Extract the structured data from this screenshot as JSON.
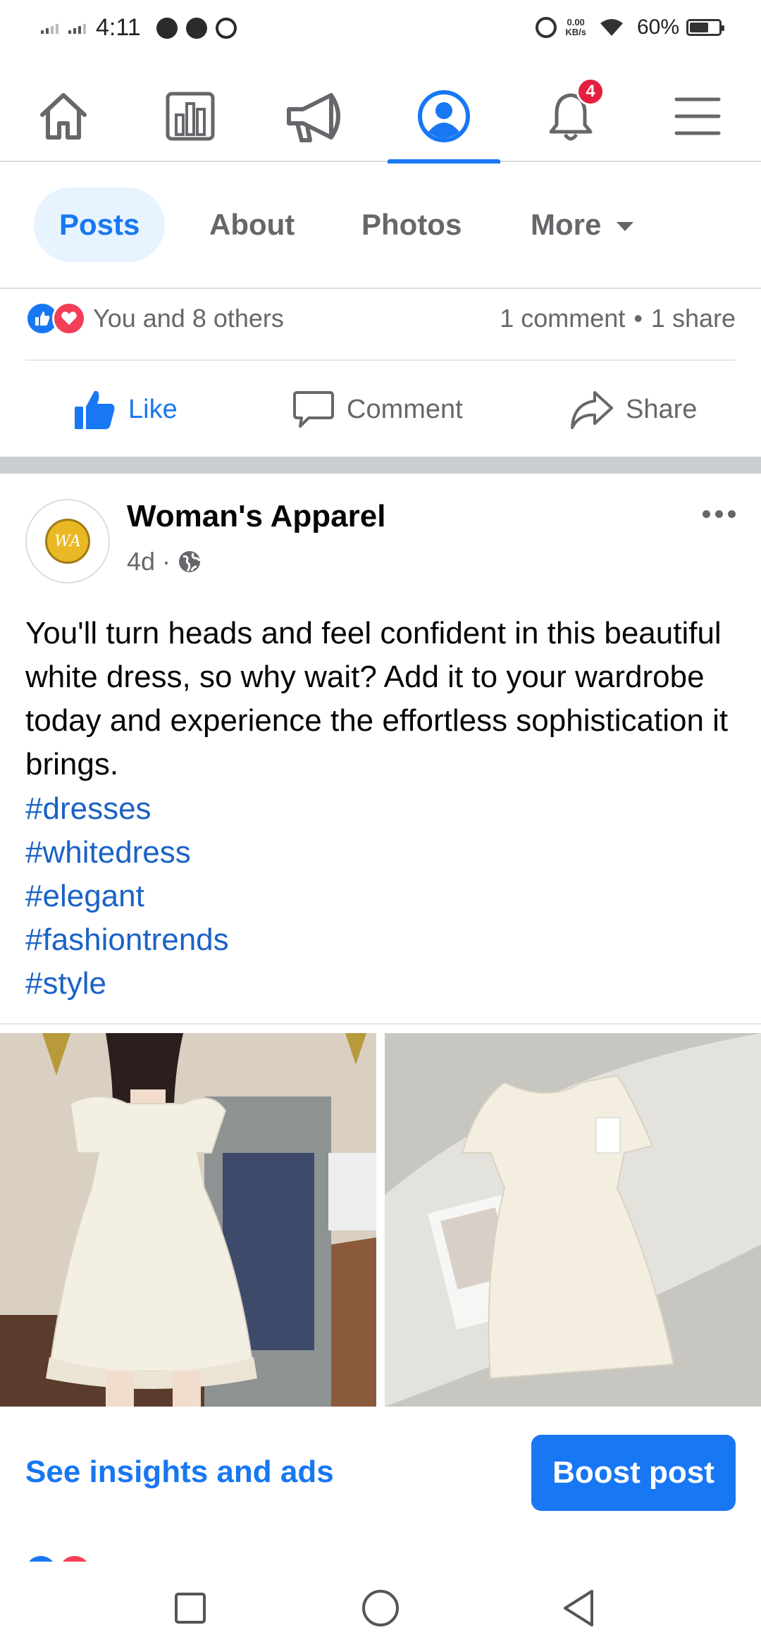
{
  "status_bar": {
    "time": "4:11",
    "net_speed_value": "0.00",
    "net_speed_unit": "KB/s",
    "battery": "60%"
  },
  "top_nav": {
    "icons": [
      "home-icon",
      "pages-icon",
      "megaphone-icon",
      "profile-icon",
      "bell-icon",
      "menu-icon"
    ],
    "active": "profile-icon",
    "notification_count": "4"
  },
  "tabs": {
    "posts": "Posts",
    "about": "About",
    "photos": "Photos",
    "more": "More"
  },
  "reactions": {
    "summary": "You and 8 others",
    "comments": "1 comment",
    "separator": "•",
    "shares": "1 share"
  },
  "actions": {
    "like": "Like",
    "comment": "Comment",
    "share": "Share"
  },
  "post": {
    "page_name": "Woman's Apparel",
    "time": "4d",
    "dot": "·",
    "avatar_initials": "WA",
    "text": "You'll turn heads and feel confident in this beautiful white dress, so why wait? Add it to your wardrobe today and experience the effortless sophistication it brings.",
    "hashtags": [
      "#dresses",
      "#whitedress",
      "#elegant",
      "#fashiontrends",
      "#style"
    ]
  },
  "post_footer": {
    "insights": "See insights and ads",
    "boost": "Boost post"
  },
  "colors": {
    "accent": "#1877f2",
    "badge": "#e41e3f",
    "love": "#f33e58",
    "hashtag": "#1a62c6"
  }
}
